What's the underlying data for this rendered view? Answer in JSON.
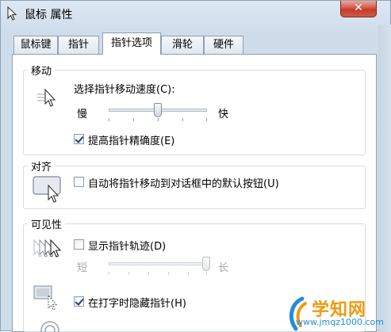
{
  "window": {
    "title": "鼠标 属性",
    "close_glyph": "✕"
  },
  "tabs": [
    {
      "label": "鼠标键",
      "active": false
    },
    {
      "label": "指针",
      "active": false
    },
    {
      "label": "指针选项",
      "active": true
    },
    {
      "label": "滑轮",
      "active": false
    },
    {
      "label": "硬件",
      "active": false
    }
  ],
  "motion": {
    "group_label": "移动",
    "speed_label": "选择指针移动速度(C):",
    "slow_label": "慢",
    "fast_label": "快",
    "speed_level": 0.5,
    "enhance_precision": {
      "label": "提高指针精确度(E)",
      "checked": true
    }
  },
  "snap": {
    "group_label": "对齐",
    "snap_to_default": {
      "label": "自动将指针移动到对话框中的默认按钮(U)",
      "checked": false
    }
  },
  "visibility": {
    "group_label": "可见性",
    "trails": {
      "label": "显示指针轨迹(D)",
      "checked": false
    },
    "short_label": "短",
    "long_label": "长",
    "trail_length": 1.0,
    "hide_while_typing": {
      "label": "在打字时隐藏指针(H)",
      "checked": true
    }
  },
  "watermark": {
    "brand": "学知网",
    "url": "www.jmqz1000.com"
  },
  "colors": {
    "close_red": "#c23c2c",
    "panel_border": "#8e9fb3",
    "watermark_orange": "#f29a0f",
    "watermark_blue": "#1f8fd3"
  }
}
